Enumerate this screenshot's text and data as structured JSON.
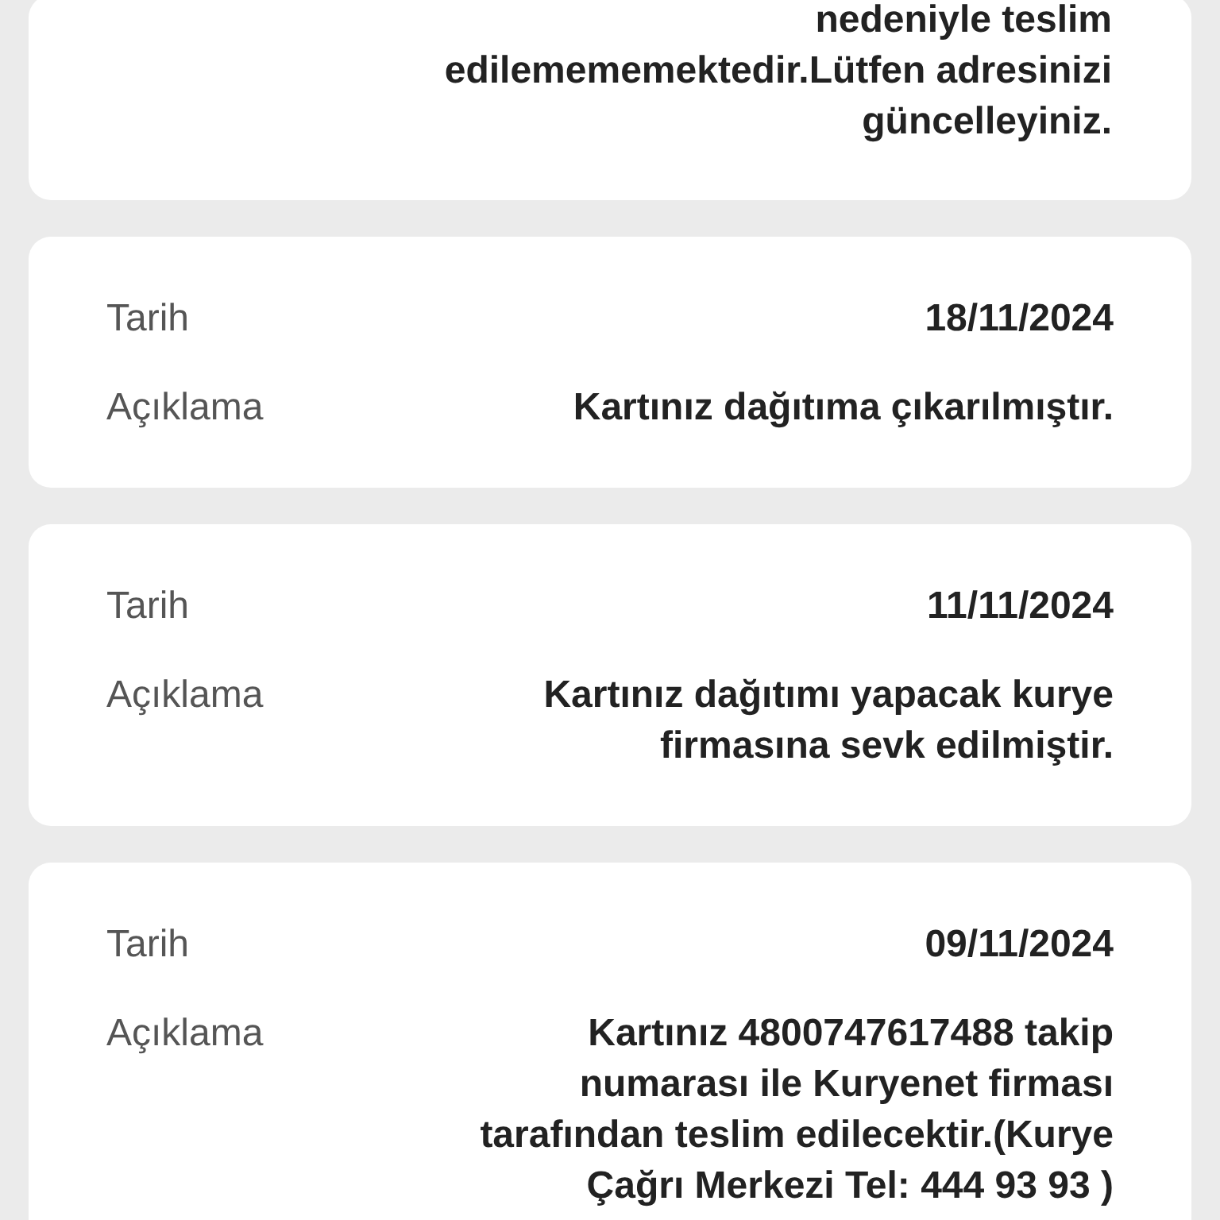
{
  "cards": [
    {
      "kind": "partial",
      "description": [
        "nedeniyle teslim",
        "edilemememektedir.Lütfen adresinizi",
        "güncelleyiniz."
      ]
    },
    {
      "kind": "full",
      "date_label": "Tarih",
      "date": "18/11/2024",
      "description_label": "Açıklama",
      "description": [
        "Kartınız dağıtıma çıkarılmıştır."
      ]
    },
    {
      "kind": "full",
      "date_label": "Tarih",
      "date": "11/11/2024",
      "description_label": "Açıklama",
      "description": [
        "Kartınız dağıtımı yapacak kurye",
        "firmasına sevk edilmiştir."
      ]
    },
    {
      "kind": "full",
      "date_label": "Tarih",
      "date": "09/11/2024",
      "description_label": "Açıklama",
      "description": [
        "Kartınız 4800747617488 takip",
        "numarası ile Kuryenet firması",
        "tarafından teslim edilecektir.(Kurye",
        "Çağrı Merkezi Tel: 444 93 93 )"
      ]
    }
  ]
}
